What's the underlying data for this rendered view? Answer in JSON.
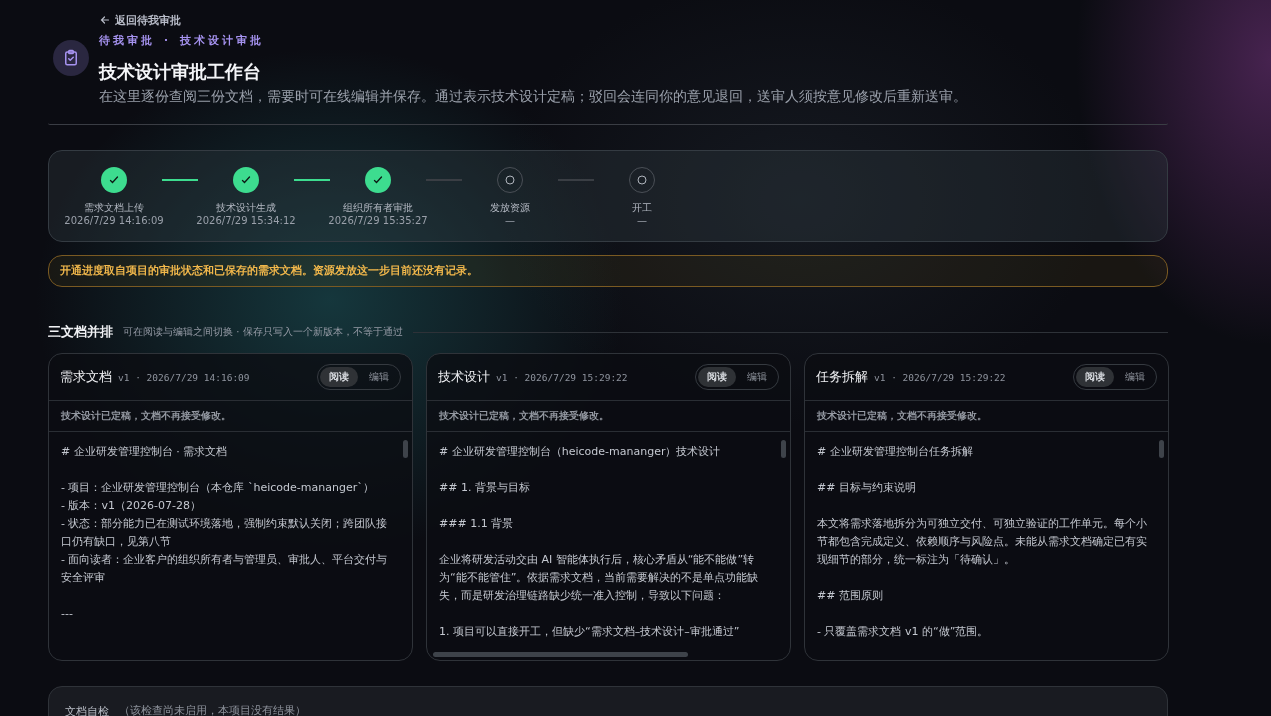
{
  "back_link": "返回待我审批",
  "breadcrumb": [
    "待我审批",
    "技术设计审批"
  ],
  "breadcrumb_separator": "·",
  "title": "技术设计审批工作台",
  "subtitle": "在这里逐份查阅三份文档，需要时可在线编辑并保存。通过表示技术设计定稿；驳回会连同你的意见退回，送审人须按意见修改后重新送审。",
  "steps": [
    {
      "label": "需求文档上传",
      "time": "2026/7/29 14:16:09",
      "done": true
    },
    {
      "label": "技术设计生成",
      "time": "2026/7/29 15:34:12",
      "done": true
    },
    {
      "label": "组织所有者审批",
      "time": "2026/7/29 15:35:27",
      "done": true
    },
    {
      "label": "发放资源",
      "time": "—",
      "done": false
    },
    {
      "label": "开工",
      "time": "—",
      "done": false
    }
  ],
  "notice": "开通进度取自项目的审批状态和已保存的需求文档。资源发放这一步目前还没有记录。",
  "section": {
    "title": "三文档并排",
    "hint": "可在阅读与编辑之间切换 · 保存只写入一个新版本，不等于通过"
  },
  "documents": [
    {
      "title": "需求文档",
      "meta": "v1 · 2026/7/29 14:16:09",
      "modes": [
        {
          "label": "阅读",
          "selected": true
        },
        {
          "label": "编辑",
          "selected": false
        }
      ],
      "lock_notice": "技术设计已定稿，文档不再接受修改。",
      "hscroll": false,
      "paragraphs": [
        [
          "# 企业研发管理控制台 · 需求文档"
        ],
        [
          "- 项目：企业研发管理控制台（本仓库 `heicode-mananger`）",
          "- 版本：v1（2026-07-28）",
          "- 状态：部分能力已在测试环境落地，强制约束默认关闭；跨团队接口仍有缺口，见第八节",
          "- 面向读者：企业客户的组织所有者与管理员、审批人、平台交付与安全评审"
        ],
        [
          "---"
        ]
      ]
    },
    {
      "title": "技术设计",
      "meta": "v1 · 2026/7/29 15:29:22",
      "modes": [
        {
          "label": "阅读",
          "selected": true
        },
        {
          "label": "编辑",
          "selected": false
        }
      ],
      "lock_notice": "技术设计已定稿，文档不再接受修改。",
      "hscroll": true,
      "paragraphs": [
        [
          "# 企业研发管理控制台（heicode-mananger）技术设计"
        ],
        [
          "## 1. 背景与目标"
        ],
        [
          "### 1.1 背景"
        ],
        [
          "企业将研发活动交由 AI 智能体执行后，核心矛盾从“能不能做”转为“能不能管住”。依据需求文档，当前需要解决的不是单点功能缺失，而是研发治理链路缺少统一准入控制，导致以下问题："
        ],
        [
          "1. 项目可以直接开工，但缺少“需求文档–技术设计–审批通过”"
        ]
      ]
    },
    {
      "title": "任务拆解",
      "meta": "v1 · 2026/7/29 15:29:22",
      "modes": [
        {
          "label": "阅读",
          "selected": true
        },
        {
          "label": "编辑",
          "selected": false
        }
      ],
      "lock_notice": "技术设计已定稿，文档不再接受修改。",
      "hscroll": false,
      "paragraphs": [
        [
          "# 企业研发管理控制台任务拆解"
        ],
        [
          "## 目标与约束说明"
        ],
        [
          "本文将需求落地拆分为可独立交付、可独立验证的工作单元。每个小节都包含完成定义、依赖顺序与风险点。未能从需求文档确定已有实现细节的部分，统一标注为「待确认」。"
        ],
        [
          "## 范围原则"
        ],
        [
          "- 只覆盖需求文档 v1 的“做”范围。"
        ]
      ]
    }
  ],
  "self_check": {
    "title": "文档自检",
    "note": "（该检查尚未启用，本项目没有结果）"
  }
}
